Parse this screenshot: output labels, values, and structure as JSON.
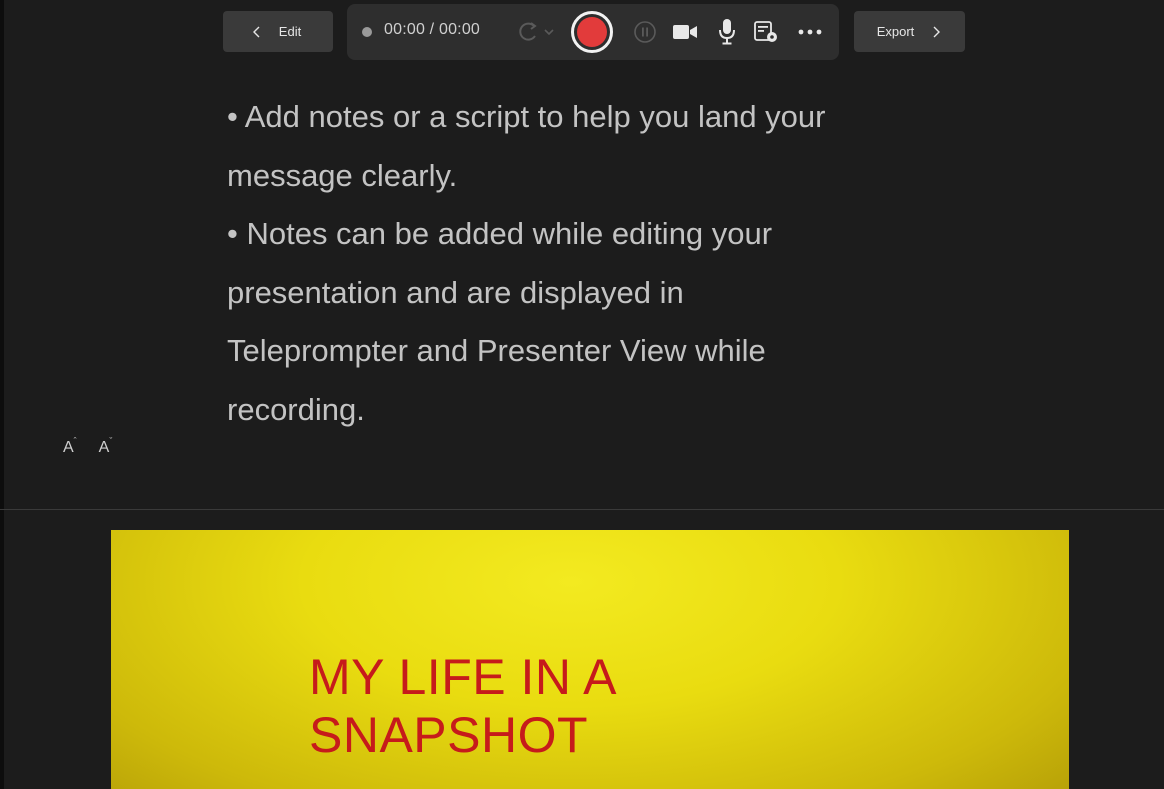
{
  "toolbar": {
    "edit_label": "Edit",
    "export_label": "Export",
    "timer": "00:00 / 00:00"
  },
  "icons": {
    "back": "chevron-left-icon",
    "forward": "chevron-right-icon",
    "status": "recording-status-dot-icon",
    "retake": "retake-icon",
    "record": "record-icon",
    "pause": "pause-icon",
    "camera": "camera-icon",
    "mic": "microphone-icon",
    "notes": "notes-settings-icon",
    "more": "more-options-icon"
  },
  "notes": {
    "lines": [
      "• Add notes or a script to help you land your",
      "message clearly.",
      "• Notes can be added while editing your",
      "presentation and are displayed in",
      "Teleprompter and Presenter View while",
      "recording."
    ]
  },
  "font_controls": {
    "increase": "A",
    "decrease": "A"
  },
  "slide": {
    "title_line1": "MY LIFE IN A",
    "title_line2": "SNAPSHOT"
  },
  "colors": {
    "background": "#1c1c1c",
    "record": "#e23b3b",
    "slide_title": "#c61b1b",
    "slide_bg": "#e9dc10"
  }
}
